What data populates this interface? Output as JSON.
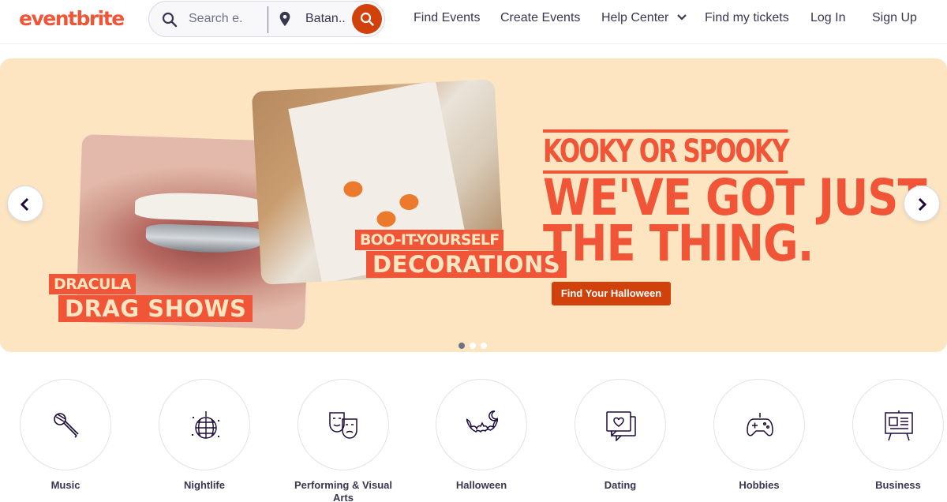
{
  "header": {
    "logo": "eventbrite",
    "search": {
      "placeholder": "Search e...",
      "location": "Batan..."
    },
    "nav": {
      "find_events": "Find Events",
      "create_events": "Create Events",
      "help_center": "Help Center",
      "find_tickets": "Find my tickets",
      "log_in": "Log In",
      "sign_up": "Sign Up"
    }
  },
  "hero": {
    "dracula": "DRACULA",
    "drag_shows": "DRAG SHOWS",
    "boo": "BOO-IT-YOURSELF",
    "decorations": "DECORATIONS",
    "kicker": "KOOKY OR SPOOKY",
    "headline_line1": "WE'VE GOT JUST",
    "headline_line2": "THE THING.",
    "cta": "Find Your Halloween",
    "slides_count": 3,
    "active_slide": 1
  },
  "categories": [
    {
      "label": "Music",
      "icon": "microphone-icon"
    },
    {
      "label": "Nightlife",
      "icon": "disco-ball-icon"
    },
    {
      "label": "Performing & Visual Arts",
      "icon": "theater-masks-icon"
    },
    {
      "label": "Halloween",
      "icon": "bat-moon-icon"
    },
    {
      "label": "Dating",
      "icon": "heart-chat-icon"
    },
    {
      "label": "Hobbies",
      "icon": "gamepad-icon"
    },
    {
      "label": "Business",
      "icon": "presentation-board-icon"
    }
  ],
  "colors": {
    "brand": "#f05537",
    "cta": "#d1410c",
    "hero_bg": "#fde5c2",
    "text": "#39364f"
  }
}
